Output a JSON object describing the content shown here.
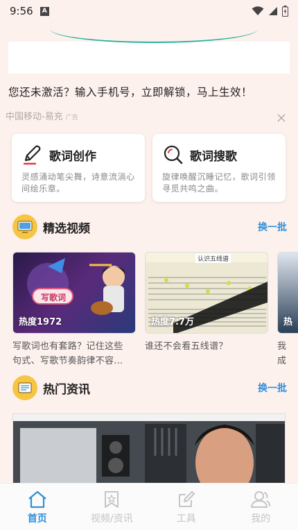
{
  "status_bar": {
    "time": "9:56",
    "notification_letter": "A"
  },
  "ad": {
    "headline": "您还未激活？输入手机号，立即解锁，马上生效！",
    "source": "中国移动-易充",
    "tag": "广告",
    "close_icon": "close-icon"
  },
  "features": [
    {
      "title": "歌词创作",
      "desc": "灵感涌动笔尖舞，诗意流淌心间绘乐章。",
      "icon": "pen-icon"
    },
    {
      "title": "歌词搜歌",
      "desc": "旋律唤醒沉睡记忆，歌词引领寻觅共鸣之曲。",
      "icon": "search-icon"
    }
  ],
  "videos_section": {
    "title": "精选视频",
    "more": "换一批"
  },
  "videos": [
    {
      "heat": "热度1972",
      "title_line1": "写歌词也有套路？记住这些",
      "title_line2": "句式、写歌节奏韵律不容…",
      "thumb_text": "写歌词"
    },
    {
      "heat": "热度7.7万",
      "title_line1": "谁还不会看五线谱？",
      "title_line2": "",
      "thumb_text": "认识五线谱"
    },
    {
      "heat": "热",
      "title_line1": "我",
      "title_line2": "成",
      "thumb_text": ""
    }
  ],
  "news_section": {
    "title": "热门资讯",
    "more": "换一批"
  },
  "bottom_nav": [
    {
      "label": "首页",
      "icon": "home-icon",
      "active": true
    },
    {
      "label": "视频/资讯",
      "icon": "bookmark-icon",
      "active": false
    },
    {
      "label": "工具",
      "icon": "edit-icon",
      "active": false
    },
    {
      "label": "我的",
      "icon": "user-icon",
      "active": false
    }
  ],
  "colors": {
    "background": "#fdf1ee",
    "accent": "#2f8fd8",
    "section_icon": "#f6c543",
    "ad_arc": "#25b29a"
  }
}
